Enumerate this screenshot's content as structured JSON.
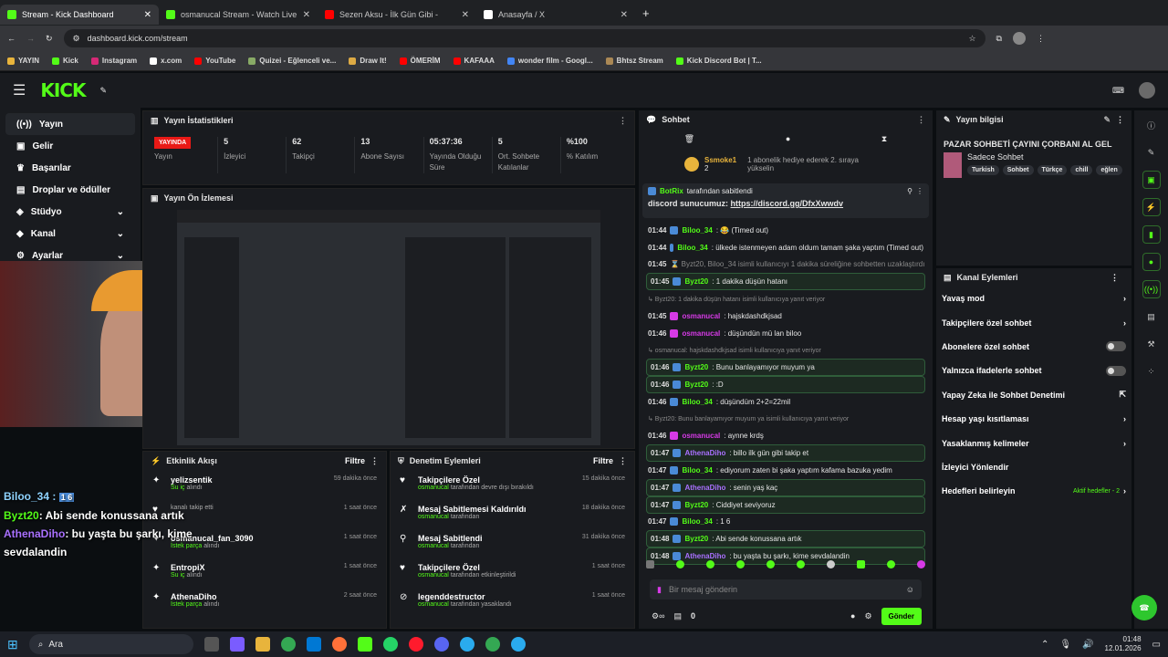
{
  "browser": {
    "tabs": [
      {
        "title": "Stream - Kick Dashboard",
        "color": "#53fc18"
      },
      {
        "title": "osmanucal Stream - Watch Live",
        "color": "#53fc18"
      },
      {
        "title": "Sezen Aksu - İlk Gün Gibi -",
        "color": "#ff0000"
      },
      {
        "title": "Anasayfa / X",
        "color": "#ffffff"
      }
    ],
    "url": "dashboard.kick.com/stream",
    "bookmarks": [
      "YAYIN",
      "Kick",
      "Instagram",
      "x.com",
      "YouTube",
      "Quizei - Eğlenceli ve...",
      "Draw It!",
      "ÖMERİM",
      "KAFAAA",
      "wonder film - Googl...",
      "Bhtsz Stream",
      "Kick Discord Bot | T..."
    ]
  },
  "app": {
    "logo": "KICK"
  },
  "sidebar": {
    "items": [
      {
        "label": "Yayın",
        "icon": "broadcast-icon"
      },
      {
        "label": "Gelir",
        "icon": "revenue-icon"
      },
      {
        "label": "Başarılar",
        "icon": "trophy-icon"
      },
      {
        "label": "Droplar ve ödüller",
        "icon": "gift-icon"
      },
      {
        "label": "Stüdyo",
        "icon": "studio-icon"
      },
      {
        "label": "Kanal",
        "icon": "channel-icon"
      },
      {
        "label": "Ayarlar",
        "icon": "settings-icon"
      }
    ]
  },
  "stats": {
    "title": "Yayın İstatistikleri",
    "live_badge": "YAYINDA",
    "items": [
      {
        "value": "",
        "label": "Yayın"
      },
      {
        "value": "5",
        "label": "İzleyici"
      },
      {
        "value": "62",
        "label": "Takipçi"
      },
      {
        "value": "13",
        "label": "Abone Sayısı"
      },
      {
        "value": "05:37:36",
        "label": "Yayında Olduğu Süre"
      },
      {
        "value": "5",
        "label": "Ort. Sohbete Katılanlar"
      },
      {
        "value": "%100",
        "label": "% Katılım"
      }
    ]
  },
  "preview": {
    "title": "Yayın Ön İzlemesi"
  },
  "activity": {
    "title": "Etkinlik Akışı",
    "filter": "Filtre",
    "rows": [
      {
        "name": "yelizsentik",
        "sub": "Su iç",
        "suffix": "alındı",
        "time": "59 dakika önce"
      },
      {
        "name": "",
        "sub": "",
        "suffix": "kanalı takip etti",
        "time": "1 saat önce"
      },
      {
        "name": "osmanucal_fan_3090",
        "sub": "İstek parça",
        "suffix": "alındı",
        "time": "1 saat önce"
      },
      {
        "name": "EntropiX",
        "sub": "Su iç",
        "suffix": "alındı",
        "time": "1 saat önce"
      },
      {
        "name": "AthenaDiho",
        "sub": "İstek parça",
        "suffix": "alındı",
        "time": "2 saat önce"
      }
    ]
  },
  "mod": {
    "title": "Denetim Eylemleri",
    "filter": "Filtre",
    "rows": [
      {
        "name": "Takipçilere Özel",
        "user": "osmanucal",
        "desc": "tarafından devre dışı bırakıldı",
        "time": "15 dakika önce"
      },
      {
        "name": "Mesaj Sabitlemesi Kaldırıldı",
        "user": "osmanucal",
        "desc": "tarafından",
        "time": "18 dakika önce"
      },
      {
        "name": "Mesaj Sabitlendi",
        "user": "osmanucal",
        "desc": "tarafından",
        "time": "31 dakika önce"
      },
      {
        "name": "Takipçilere Özel",
        "user": "osmanucal",
        "desc": "tarafından etkinleştirildi",
        "time": "1 saat önce"
      },
      {
        "name": "legenddestructor",
        "user": "osmanucal",
        "desc": "tarafından yasaklandı",
        "time": "1 saat önce"
      }
    ]
  },
  "chat": {
    "title": "Sohbet",
    "gift_user": "Ssmoke1",
    "gift_text": "1 abonelik hediye ederek 2. sıraya yükselin",
    "gift_rank": "2",
    "pinned_by": "BotRix",
    "pinned_text": "tarafından sabitlendi",
    "pinned_msg": "discord sunucumuz:",
    "pinned_link": "https://discord.gg/DfxXwwdv",
    "placeholder": "Bir mesaj gönderin",
    "send": "Gönder",
    "points": "0",
    "messages": [
      {
        "t": "01:44",
        "u": "Biloo_34",
        "c": "#53fc18",
        "m": ": 😂 (Timed out)",
        "k": ""
      },
      {
        "t": "01:44",
        "u": "Biloo_34",
        "c": "#53fc18",
        "m": ": ülkede istenmeyen adam oldum tamam şaka yaptım (Timed out)",
        "k": ""
      },
      {
        "t": "01:45",
        "u": "",
        "c": "#888",
        "m": "⌛ Byzt20, Biloo_34 isimli kullanıcıyı 1 dakika süreliğine sohbetten uzaklaştırdı",
        "k": "sys"
      },
      {
        "t": "01:45",
        "u": "Byzt20",
        "c": "#53fc18",
        "m": ": 1 dakika düşün hatanı",
        "k": "box"
      },
      {
        "t": "",
        "u": "",
        "c": "#888",
        "m": "↳ Byzt20: 1 dakika düşün hatanı isimli kullanıcıya yanıt veriyor",
        "k": "reply"
      },
      {
        "t": "01:45",
        "u": "osmanucal",
        "c": "#d63ae6",
        "m": ": hajskdashdkjsad",
        "k": ""
      },
      {
        "t": "01:46",
        "u": "osmanucal",
        "c": "#d63ae6",
        "m": ": düşündün mü lan biloo",
        "k": ""
      },
      {
        "t": "",
        "u": "",
        "c": "#888",
        "m": "↳ osmanucal: hajskdashdkjsad isimli kullanıcıya yanıt veriyor",
        "k": "reply"
      },
      {
        "t": "01:46",
        "u": "Byzt20",
        "c": "#53fc18",
        "m": ": Bunu banlayamıyor muyum ya",
        "k": "box"
      },
      {
        "t": "01:46",
        "u": "Byzt20",
        "c": "#53fc18",
        "m": ": :D",
        "k": "box"
      },
      {
        "t": "01:46",
        "u": "Biloo_34",
        "c": "#53fc18",
        "m": ": düşündüm 2+2=22mil",
        "k": ""
      },
      {
        "t": "",
        "u": "",
        "c": "#888",
        "m": "↳ Byzt20: Bunu banlayamıyor muyum ya isimli kullanıcıya yanıt veriyor",
        "k": "reply"
      },
      {
        "t": "01:46",
        "u": "osmanucal",
        "c": "#d63ae6",
        "m": ": aynne krdş",
        "k": ""
      },
      {
        "t": "01:47",
        "u": "AthenaDiho",
        "c": "#a970ff",
        "m": ": billo ilk gün gibi takip et",
        "k": "box"
      },
      {
        "t": "01:47",
        "u": "Biloo_34",
        "c": "#53fc18",
        "m": ": ediyorum zaten bi şaka yaptım kafama bazuka yedim",
        "k": ""
      },
      {
        "t": "01:47",
        "u": "AthenaDiho",
        "c": "#a970ff",
        "m": ": senin yaş kaç",
        "k": "box"
      },
      {
        "t": "01:47",
        "u": "Byzt20",
        "c": "#53fc18",
        "m": ": Ciddiyet seviyoruz",
        "k": "box"
      },
      {
        "t": "01:47",
        "u": "Biloo_34",
        "c": "#53fc18",
        "m": ": 1 6",
        "k": ""
      },
      {
        "t": "01:48",
        "u": "Byzt20",
        "c": "#53fc18",
        "m": ": Abi sende konussana artık",
        "k": "box"
      },
      {
        "t": "01:48",
        "u": "AthenaDiho",
        "c": "#a970ff",
        "m": ": bu yaşta bu şarkı, kime sevdalandin",
        "k": "box"
      }
    ]
  },
  "info": {
    "title": "Yayın bilgisi",
    "stream_title": "PAZAR SOHBETİ ÇAYINI ÇORBANI AL GEL",
    "category": "Sadece Sohbet",
    "tags": [
      "Turkish",
      "Sohbet",
      "Türkçe",
      "chill",
      "eğlen"
    ]
  },
  "channel_actions": {
    "title": "Kanal Eylemleri",
    "items": [
      {
        "label": "Yavaş mod",
        "type": "arrow"
      },
      {
        "label": "Takipçilere özel sohbet",
        "type": "arrow"
      },
      {
        "label": "Abonelere özel sohbet",
        "type": "toggle"
      },
      {
        "label": "Yalnızca ifadelerle sohbet",
        "type": "toggle"
      },
      {
        "label": "Yapay Zeka ile Sohbet Denetimi",
        "type": "ext"
      },
      {
        "label": "Hesap yaşı kısıtlaması",
        "type": "arrow"
      },
      {
        "label": "Yasaklanmış kelimeler",
        "type": "arrow"
      },
      {
        "label": "İzleyici Yönlendir",
        "type": "none"
      },
      {
        "label": "Hedefleri belirleyin",
        "type": "goal",
        "extra": "Aktif hedefler - 2"
      }
    ]
  },
  "overlay": {
    "user1": "Biloo_34 :",
    "badges1": "1 6",
    "user2": "Byzt20",
    "msg2": ": Abi sende konussana artık",
    "user3": "AthenaDiho",
    "msg3": ": bu yaşta bu şarkı, kime sevdalandin"
  },
  "taskbar": {
    "search": "Ara",
    "time": "01:48",
    "date": "12.01.2026"
  }
}
